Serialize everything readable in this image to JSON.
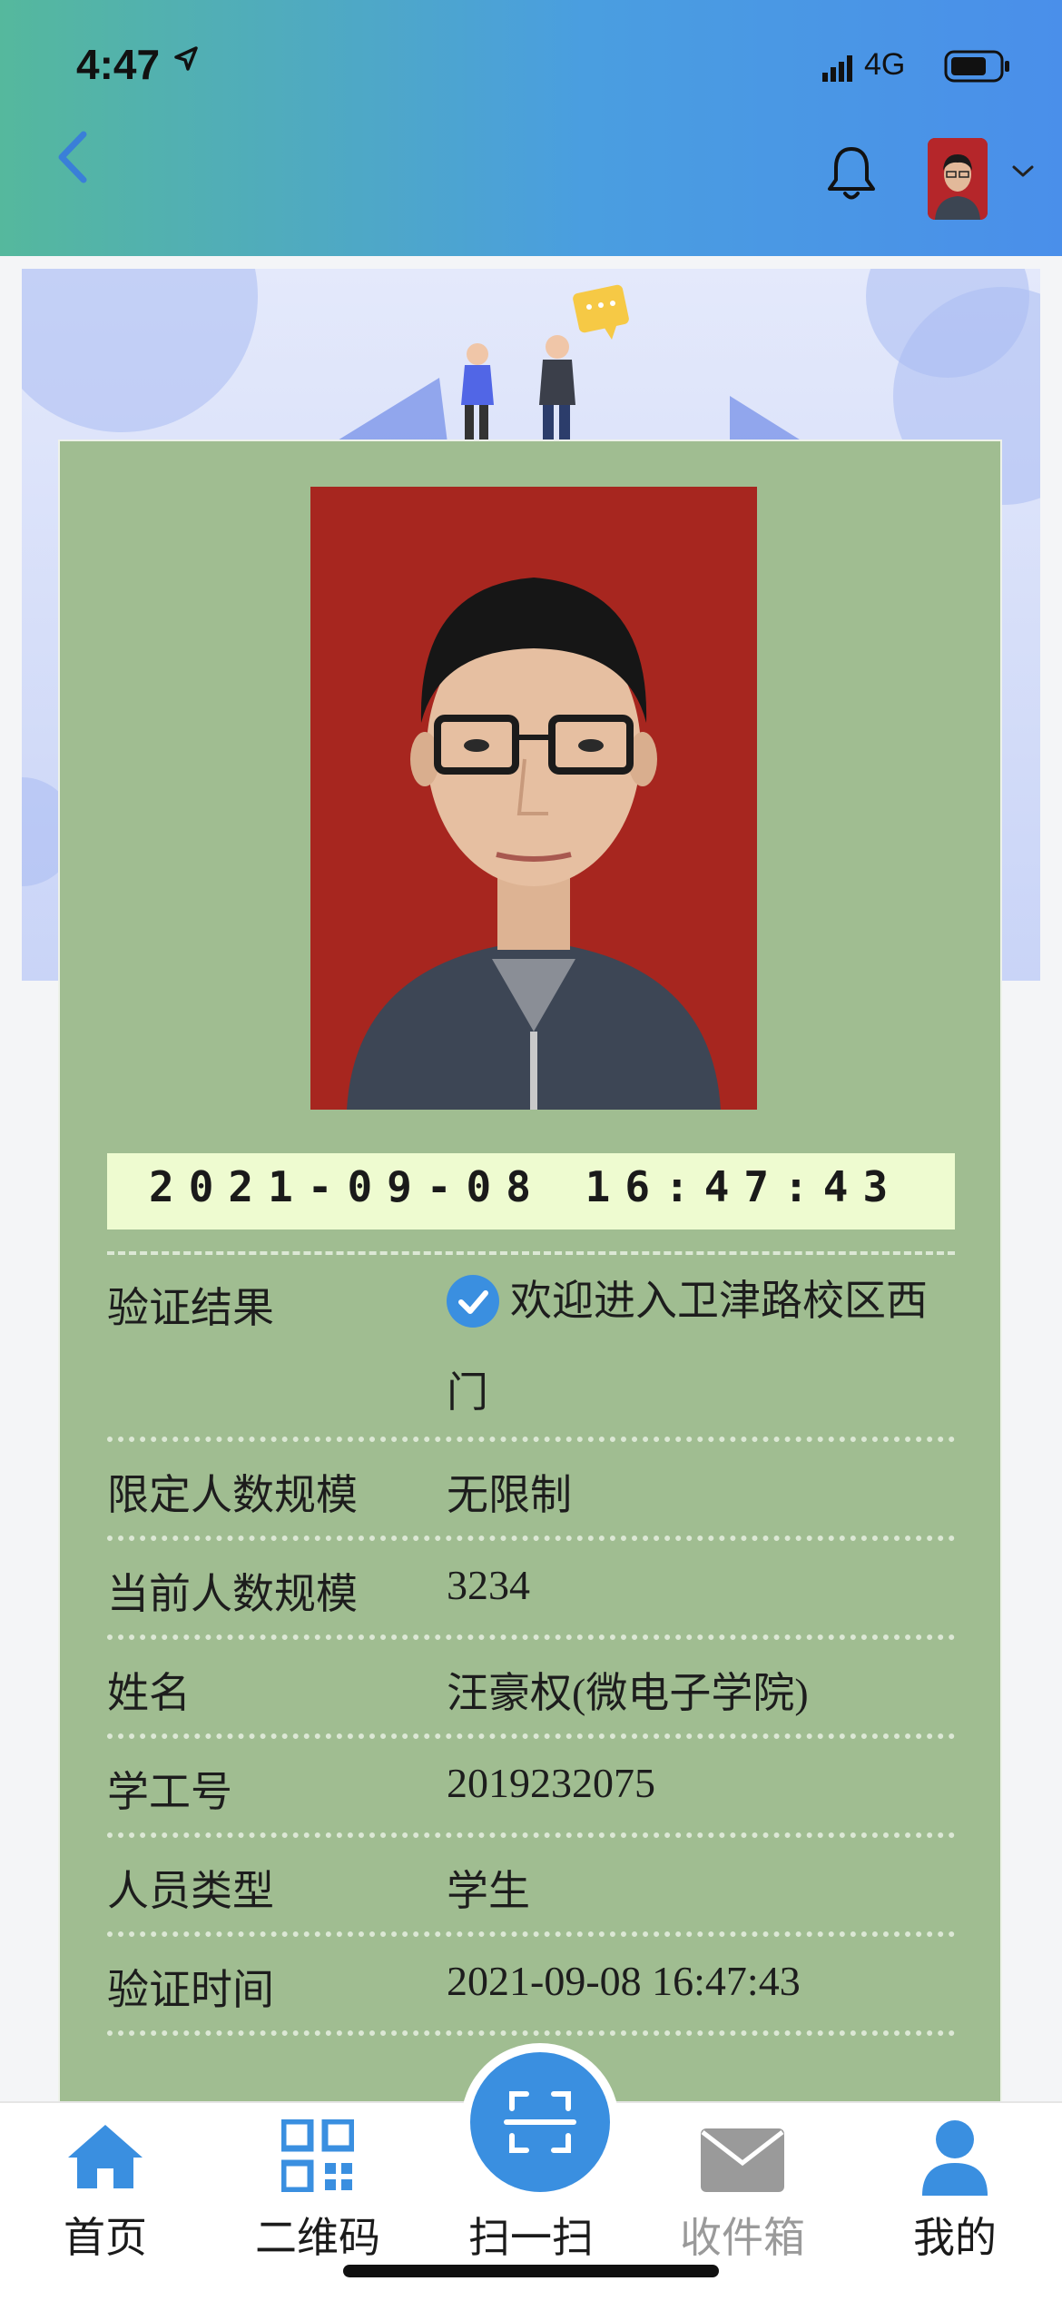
{
  "status_bar": {
    "time": "4:47",
    "network": "4G"
  },
  "header": {
    "back_icon": "chevron-left-icon",
    "bell_icon": "bell-icon",
    "caret_icon": "chevron-down-icon"
  },
  "card": {
    "timestamp": "2021-09-08 16:47:43",
    "rows": [
      {
        "label": "验证结果",
        "value": "欢迎进入卫津路校区西门"
      },
      {
        "label": "限定人数规模",
        "value": "无限制"
      },
      {
        "label": "当前人数规模",
        "value": "3234"
      },
      {
        "label": "姓名",
        "value": "汪豪权(微电子学院)"
      },
      {
        "label": "学工号",
        "value": "2019232075"
      },
      {
        "label": "人员类型",
        "value": "学生"
      },
      {
        "label": "验证时间",
        "value": "2021-09-08 16:47:43"
      }
    ]
  },
  "tabbar": {
    "tabs": [
      {
        "label": "首页",
        "icon": "home-icon"
      },
      {
        "label": "二维码",
        "icon": "qr-code-icon"
      },
      {
        "label": "扫一扫",
        "icon": "scan-icon"
      },
      {
        "label": "收件箱",
        "icon": "mail-icon"
      },
      {
        "label": "我的",
        "icon": "user-icon"
      }
    ]
  },
  "colors": {
    "accent": "#3a8fe0",
    "card_bg": "#a0bd91",
    "timestamp_bg": "#eefbd0",
    "photo_bg": "#a7261f"
  }
}
